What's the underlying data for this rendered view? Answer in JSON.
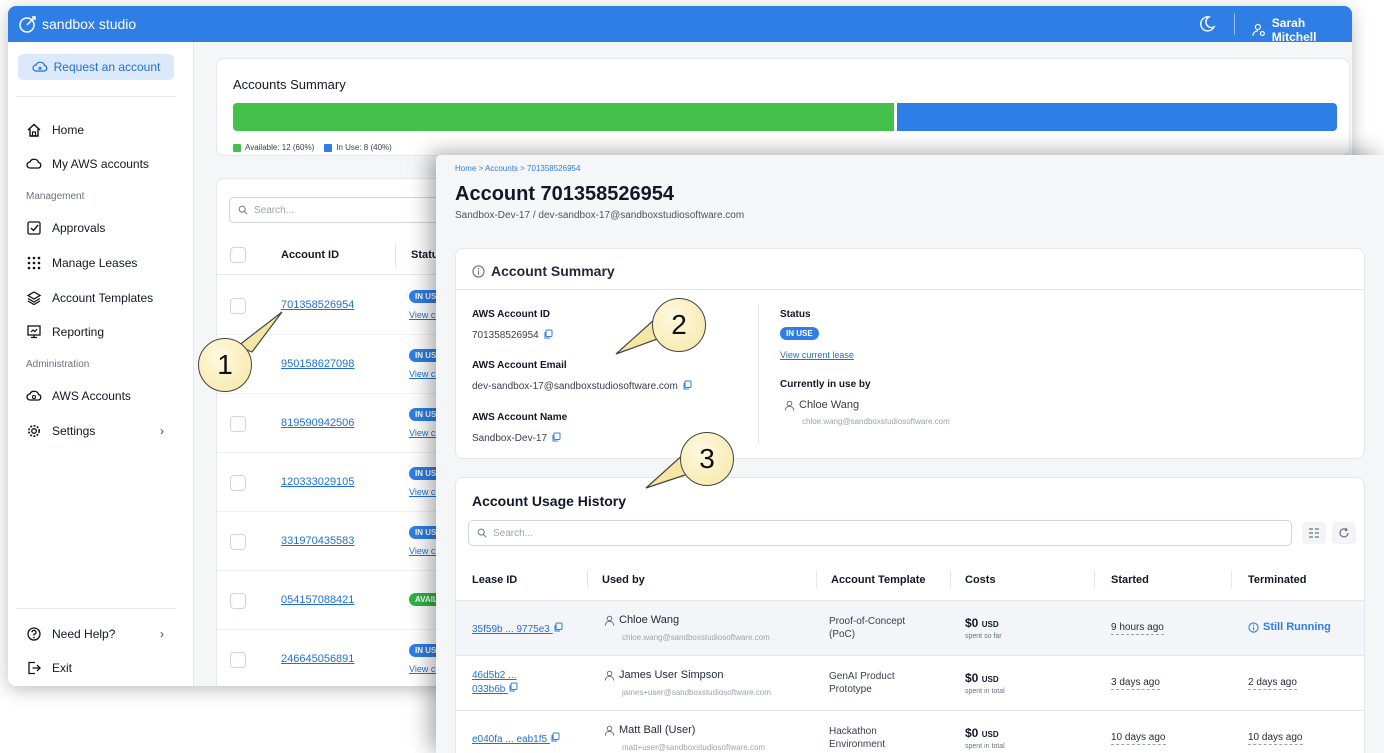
{
  "app": {
    "brand": "sandbox studio",
    "user_name": "Sarah Mitchell"
  },
  "colors": {
    "primary": "#2e7ee6",
    "available": "#43c14b",
    "in_use": "#2e7ee6"
  },
  "sidebar": {
    "request_button": "Request an account",
    "items": [
      {
        "label": "Home",
        "icon": "home-icon"
      },
      {
        "label": "My AWS accounts",
        "icon": "cloud-icon"
      },
      {
        "label": "Approvals",
        "icon": "checkbox-icon"
      },
      {
        "label": "Manage Leases",
        "icon": "grid-icon"
      },
      {
        "label": "Account Templates",
        "icon": "layers-icon"
      },
      {
        "label": "Reporting",
        "icon": "presentation-icon"
      },
      {
        "label": "AWS Accounts",
        "icon": "aws-cloud-icon"
      },
      {
        "label": "Settings",
        "icon": "gear-icon"
      }
    ],
    "section_management": "Management",
    "section_administration": "Administration",
    "need_help": "Need Help?",
    "exit": "Exit"
  },
  "summary": {
    "title": "Accounts Summary",
    "available_label": "Available: 12 (60%)",
    "in_use_label": "In Use: 8 (40%)",
    "available_fraction": 0.6
  },
  "accounts_list": {
    "search_placeholder": "Search...",
    "col_account_id": "Account ID",
    "col_status": "Status",
    "view_current_label": "View curr",
    "rows": [
      {
        "id": "701358526954",
        "status": "IN USE"
      },
      {
        "id": "950158627098",
        "status": "IN USE"
      },
      {
        "id": "819590942506",
        "status": "IN USE"
      },
      {
        "id": "120333029105",
        "status": "IN USE"
      },
      {
        "id": "331970435583",
        "status": "IN USE"
      },
      {
        "id": "054157088421",
        "status": "AVAILA"
      },
      {
        "id": "246645056891",
        "status": "IN USE"
      }
    ]
  },
  "callouts": [
    "1",
    "2",
    "3"
  ],
  "detail": {
    "breadcrumb": "Home  >  Accounts  >  701358526954",
    "title": "Account 701358526954",
    "subtitle": "Sandbox-Dev-17 / dev-sandbox-17@sandboxstudiosoftware.com",
    "summary_title": "Account Summary",
    "aws_account_id_label": "AWS Account ID",
    "aws_account_id": "701358526954",
    "aws_account_email_label": "AWS Account Email",
    "aws_account_email": "dev-sandbox-17@sandboxstudiosoftware.com",
    "aws_account_name_label": "AWS Account Name",
    "aws_account_name": "Sandbox-Dev-17",
    "status_label": "Status",
    "status_badge": "IN USE",
    "view_lease": "View current lease",
    "in_use_by_label": "Currently in use by",
    "in_use_by_name": "Chloe Wang",
    "in_use_by_email": "chloe.wang@sandboxstudiosoftware.com"
  },
  "history": {
    "title": "Account Usage History",
    "search_placeholder": "Search...",
    "columns": [
      "Lease ID",
      "Used by",
      "Account Template",
      "Costs",
      "Started",
      "Terminated"
    ],
    "rows": [
      {
        "lease_1": "35f59b ... 9775e3",
        "lease_2": "",
        "name": "Chloe Wang",
        "email": "chloe.wang@sandboxstudiosoftware.com",
        "template_1": "Proof-of-Concept",
        "template_2": "(PoC)",
        "cost": "$0",
        "cost_unit": "USD",
        "cost_sub": "spent so far",
        "started": "9 hours ago",
        "terminated": "Still Running"
      },
      {
        "lease_1": "46d5b2 ...",
        "lease_2": "033b6b",
        "name": "James User Simpson",
        "email": "james+user@sandboxstudiosoftware.com",
        "template_1": "GenAI Product",
        "template_2": "Prototype",
        "cost": "$0",
        "cost_unit": "USD",
        "cost_sub": "spent in total",
        "started": "3 days ago",
        "terminated": "2 days ago"
      },
      {
        "lease_1": "e040fa ... eab1f5",
        "lease_2": "",
        "name": "Matt Ball (User)",
        "email": "matt+user@sandboxstudiosoftware.com",
        "template_1": "Hackathon",
        "template_2": "Environment",
        "cost": "$0",
        "cost_unit": "USD",
        "cost_sub": "spent in total",
        "started": "10 days ago",
        "terminated": "10 days ago"
      }
    ]
  }
}
